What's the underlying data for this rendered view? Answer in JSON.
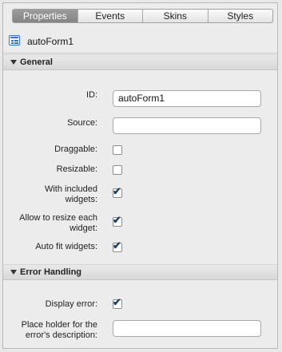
{
  "tabs": [
    {
      "label": "Properties",
      "active": true
    },
    {
      "label": "Events",
      "active": false
    },
    {
      "label": "Skins",
      "active": false
    },
    {
      "label": "Styles",
      "active": false
    }
  ],
  "object": {
    "name": "autoForm1",
    "icon": "form-icon"
  },
  "sections": {
    "general": {
      "label": "General",
      "expanded": true
    },
    "error_handling": {
      "label": "Error Handling",
      "expanded": true
    }
  },
  "fields": {
    "id": {
      "label": "ID:",
      "value": "autoForm1"
    },
    "source": {
      "label": "Source:",
      "value": ""
    },
    "draggable": {
      "label": "Draggable:",
      "checked": false
    },
    "resizable": {
      "label": "Resizable:",
      "checked": false
    },
    "with_included_widgets": {
      "label_line1": "With included",
      "label_line2": "widgets:",
      "checked": true
    },
    "allow_resize_each": {
      "label_line1": "Allow to resize each",
      "label_line2": "widget:",
      "checked": true
    },
    "auto_fit_widgets": {
      "label": "Auto fit widgets:",
      "checked": true
    },
    "display_error": {
      "label": "Display error:",
      "checked": true
    },
    "placeholder_error": {
      "label_line1": "Place holder for the",
      "label_line2": "error's description:",
      "value": ""
    }
  },
  "check_glyph": "✔"
}
